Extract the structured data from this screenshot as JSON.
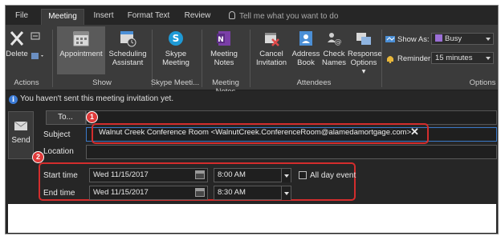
{
  "tabs": [
    "File",
    "Meeting",
    "Insert",
    "Format Text",
    "Review"
  ],
  "active_tab": "Meeting",
  "tell_me": "Tell me what you want to do",
  "ribbon": {
    "actions": {
      "delete": "Delete",
      "label": "Actions"
    },
    "show": {
      "appointment": "Appointment",
      "scheduling": "Scheduling",
      "scheduling2": "Assistant",
      "label": "Show"
    },
    "skype": {
      "line1": "Skype",
      "line2": "Meeting",
      "label": "Skype Meeti..."
    },
    "notes": {
      "line1": "Meeting",
      "line2": "Notes",
      "label": "Meeting Notes"
    },
    "attendees": {
      "cancel1": "Cancel",
      "cancel2": "Invitation",
      "address1": "Address",
      "address2": "Book",
      "check1": "Check",
      "check2": "Names",
      "response1": "Response",
      "response2": "Options",
      "label": "Attendees"
    },
    "options": {
      "show_as_label": "Show As:",
      "show_as_value": "Busy",
      "reminder_label": "Reminder:",
      "reminder_value": "15 minutes",
      "label": "Options"
    }
  },
  "info_message": "You haven't sent this meeting invitation yet.",
  "form": {
    "send": "Send",
    "to_button": "To...",
    "subject_label": "Subject",
    "location_label": "Location",
    "to_value": "Walnut Creek Conference Room <WalnutCreek.ConferenceRoom@alamedamortgage.com>",
    "start_label": "Start time",
    "start_date": "Wed 11/15/2017",
    "start_time": "8:00 AM",
    "end_label": "End time",
    "end_date": "Wed 11/15/2017",
    "end_time": "8:30 AM",
    "all_day": "All day event"
  },
  "badges": [
    "1",
    "2"
  ],
  "colors": {
    "accent_red": "#d32d2d",
    "busy_purple": "#9b6fd6",
    "info_blue": "#3c7bd6",
    "onenote_purple": "#7b3fa8"
  }
}
